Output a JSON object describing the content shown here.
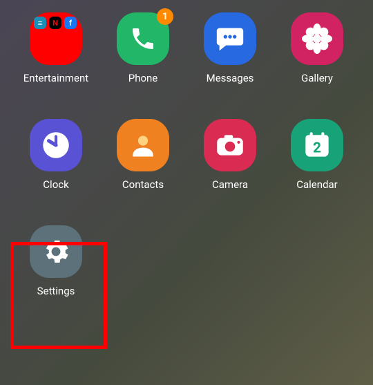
{
  "apps": {
    "entertainment": {
      "label": "Entertainment"
    },
    "phone": {
      "label": "Phone",
      "badge": "1"
    },
    "messages": {
      "label": "Messages"
    },
    "gallery": {
      "label": "Gallery"
    },
    "clock": {
      "label": "Clock"
    },
    "contacts": {
      "label": "Contacts"
    },
    "camera": {
      "label": "Camera"
    },
    "calendar": {
      "label": "Calendar",
      "day": "2"
    },
    "settings": {
      "label": "Settings"
    }
  },
  "folder_minis": {
    "a": "≡",
    "b": "N",
    "c": "f"
  },
  "colors": {
    "red": "#ff0000",
    "green": "#22b768",
    "blue": "#2769e0",
    "magenta": "#d12361",
    "purple": "#5a52d4",
    "orange": "#ef8121",
    "crimson": "#da2c52",
    "teal": "#17a277",
    "slate": "#5c717a",
    "badge": "#ff8a00"
  }
}
